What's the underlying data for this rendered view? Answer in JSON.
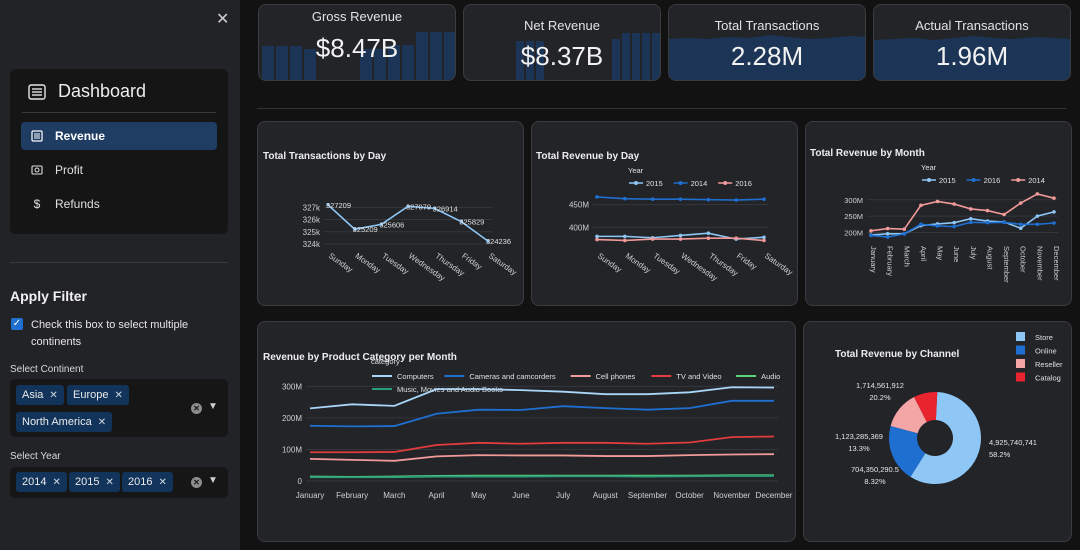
{
  "sidebar": {
    "menu_title": "Dashboard",
    "items": [
      {
        "label": "Revenue",
        "icon": "revenue-icon"
      },
      {
        "label": "Profit",
        "icon": "profit-icon"
      },
      {
        "label": "Refunds",
        "icon": "dollar-icon"
      }
    ],
    "filter_title": "Apply Filter",
    "multi_checkbox_label": "Check this box to select multiple continents",
    "continent_label": "Select Continent",
    "continents": [
      "Asia",
      "Europe",
      "North America"
    ],
    "year_label": "Select Year",
    "years": [
      "2014",
      "2015",
      "2016"
    ]
  },
  "kpis": [
    {
      "label": "Gross Revenue",
      "value": "$8.47B"
    },
    {
      "label": "Net Revenue",
      "value": "$8.37B"
    },
    {
      "label": "Total Transactions",
      "value": "2.28M"
    },
    {
      "label": "Actual Transactions",
      "value": "1.96M"
    }
  ],
  "colors": {
    "accent": "#1f6fd1",
    "active_menu": "#1f3d63",
    "panel_bg": "#222428"
  },
  "chart_data": [
    {
      "id": "transactions-by-day",
      "type": "line",
      "title": "Total Transactions by Day",
      "categories": [
        "Sunday",
        "Monday",
        "Tuesday",
        "Wednesday",
        "Thursday",
        "Friday",
        "Saturday"
      ],
      "y_ticks": [
        "327k",
        "326k",
        "325k",
        "324k"
      ],
      "series": [
        {
          "values": [
            327209,
            325209,
            325606,
            327079,
            326914,
            325829,
            324236
          ],
          "data_labels": [
            "327209",
            "325209",
            "325606",
            "327079",
            "326914",
            "325829",
            "324236"
          ]
        }
      ],
      "ylim": [
        324000,
        327600
      ]
    },
    {
      "id": "revenue-by-day",
      "type": "line",
      "title": "Total Revenue by Day",
      "legend_title": "Year",
      "categories": [
        "Sunday",
        "Monday",
        "Tuesday",
        "Wednesday",
        "Thursday",
        "Friday",
        "Saturday"
      ],
      "y_ticks": [
        "450M",
        "400M"
      ],
      "series": [
        {
          "name": "2015",
          "color": "#8ec6f5",
          "values": [
            380,
            380,
            377,
            382,
            387,
            374,
            378
          ]
        },
        {
          "name": "2014",
          "color": "#1f6fd1",
          "values": [
            467,
            463,
            462,
            462,
            461,
            460,
            462
          ]
        },
        {
          "name": "2016",
          "color": "#f29a9a",
          "values": [
            373,
            371,
            374,
            374,
            376,
            376,
            371
          ]
        }
      ],
      "ylim": [
        350,
        480
      ]
    },
    {
      "id": "revenue-by-month",
      "type": "line",
      "title": "Total Revenue by Month",
      "legend_title": "Year",
      "categories": [
        "January",
        "February",
        "March",
        "April",
        "May",
        "June",
        "July",
        "August",
        "September",
        "October",
        "November",
        "December"
      ],
      "y_ticks": [
        "300M",
        "250M",
        "200M"
      ],
      "series": [
        {
          "name": "2015",
          "color": "#8ec6f5",
          "values": [
            192,
            196,
            196,
            221,
            226,
            230,
            242,
            235,
            232,
            213,
            250,
            263
          ]
        },
        {
          "name": "2016",
          "color": "#1f6fd1",
          "values": [
            191,
            186,
            196,
            225,
            220,
            218,
            231,
            230,
            231,
            225,
            225,
            229
          ]
        },
        {
          "name": "2014",
          "color": "#f29a9a",
          "values": [
            205,
            212,
            210,
            283,
            295,
            287,
            272,
            267,
            255,
            290,
            318,
            305
          ]
        }
      ],
      "ylim": [
        180,
        330
      ]
    },
    {
      "id": "revenue-by-category",
      "type": "line",
      "title": "Revenue by Product Category per Month",
      "legend_title": "category",
      "categories": [
        "January",
        "February",
        "March",
        "April",
        "May",
        "June",
        "July",
        "August",
        "September",
        "October",
        "November",
        "December"
      ],
      "y_ticks": [
        "300M",
        "200M",
        "100M",
        "0"
      ],
      "series": [
        {
          "name": "Computers",
          "color": "#a9d5f7",
          "values": [
            230,
            243,
            238,
            291,
            291,
            288,
            283,
            275,
            275,
            281,
            297,
            296
          ]
        },
        {
          "name": "Cameras and camcorders",
          "color": "#1f6fd1",
          "values": [
            175,
            173,
            174,
            213,
            226,
            225,
            237,
            231,
            226,
            231,
            254,
            254
          ]
        },
        {
          "name": "Cell phones",
          "color": "#f29a9a",
          "values": [
            70,
            67,
            64,
            78,
            82,
            81,
            81,
            79,
            79,
            82,
            84,
            85
          ]
        },
        {
          "name": "TV and Video",
          "color": "#e03c3c",
          "values": [
            91,
            91,
            92,
            114,
            121,
            118,
            121,
            121,
            118,
            122,
            139,
            141
          ]
        },
        {
          "name": "Audio",
          "color": "#5fd17a",
          "values": [
            14,
            13,
            14,
            16,
            17,
            17,
            17,
            17,
            17,
            17,
            18,
            18
          ]
        },
        {
          "name": "Music, Movies and Audio Books",
          "color": "#2a9d7a",
          "values": [
            12,
            12,
            12,
            14,
            14,
            14,
            15,
            15,
            14,
            15,
            16,
            16
          ]
        }
      ],
      "ylim": [
        0,
        320
      ]
    },
    {
      "id": "revenue-by-channel",
      "type": "pie",
      "title": "Total Revenue by Channel",
      "slices": [
        {
          "name": "Store",
          "value": 4925740741,
          "label": "4,925,740,741",
          "percent": "58.2%",
          "color": "#8ec6f5"
        },
        {
          "name": "Online",
          "value": 1714561912,
          "label": "1,714,561,912",
          "percent": "20.2%",
          "color": "#1f6fd1"
        },
        {
          "name": "Reseller",
          "value": 1123285369,
          "label": "1,123,285,369",
          "percent": "13.3%",
          "color": "#f4a6a6"
        },
        {
          "name": "Catalog",
          "value": 704350290.5,
          "label": "704,350,290.5",
          "percent": "8.32%",
          "color": "#e8242e"
        }
      ]
    }
  ]
}
